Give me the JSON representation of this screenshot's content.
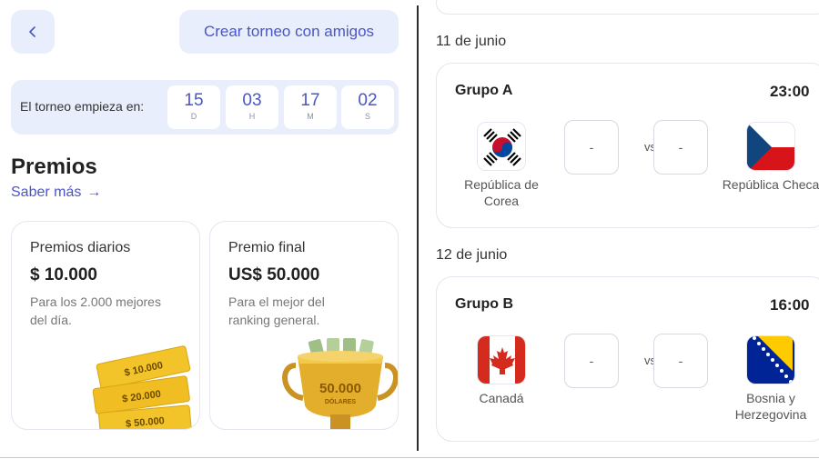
{
  "header": {
    "create_label": "Crear torneo con amigos"
  },
  "countdown": {
    "label": "El torneo empieza en:",
    "units": [
      {
        "value": "15",
        "unit": "D"
      },
      {
        "value": "03",
        "unit": "H"
      },
      {
        "value": "17",
        "unit": "M"
      },
      {
        "value": "02",
        "unit": "S"
      }
    ]
  },
  "prizes": {
    "title": "Premios",
    "more_link": "Saber más",
    "cards": [
      {
        "title": "Premios diarios",
        "amount": "$ 10.000",
        "desc": "Para los 2.000 mejores del día.",
        "art_labels": [
          "$ 10.000",
          "$ 20.000",
          "$ 50.000"
        ]
      },
      {
        "title": "Premio final",
        "amount": "US$ 50.000",
        "desc": "Para el mejor del ranking general.",
        "art_labels": [
          "50.000",
          "DÓLARES"
        ]
      }
    ]
  },
  "matches": [
    {
      "date": "11 de junio",
      "group": "Grupo A",
      "time": "23:00",
      "home": {
        "name": "República de Corea",
        "flag": "korea-flag-icon"
      },
      "away": {
        "name": "República Checa",
        "flag": "czech-flag-icon"
      },
      "home_score": "-",
      "away_score": "-",
      "vs": "vs"
    },
    {
      "date": "12 de junio",
      "group": "Grupo B",
      "time": "16:00",
      "home": {
        "name": "Canadá",
        "flag": "canada-flag-icon"
      },
      "away": {
        "name": "Bosnia y Herzegovina",
        "flag": "bosnia-flag-icon"
      },
      "home_score": "-",
      "away_score": "-",
      "vs": "vs"
    }
  ],
  "colors": {
    "accent": "#4a55c9",
    "panel_bg": "#e8eefb",
    "card_border": "#e3e6ee",
    "gold": "#e8b820"
  }
}
